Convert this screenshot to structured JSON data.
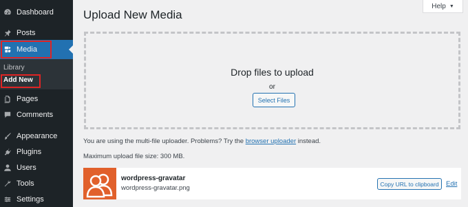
{
  "sidebar": {
    "items": [
      {
        "label": "Dashboard",
        "icon": "dashboard-icon"
      },
      {
        "label": "Posts",
        "icon": "pin-icon"
      },
      {
        "label": "Media",
        "icon": "media-icon"
      },
      {
        "label": "Pages",
        "icon": "page-icon"
      },
      {
        "label": "Comments",
        "icon": "comment-icon"
      },
      {
        "label": "Appearance",
        "icon": "brush-icon"
      },
      {
        "label": "Plugins",
        "icon": "plugin-icon"
      },
      {
        "label": "Users",
        "icon": "user-icon"
      },
      {
        "label": "Tools",
        "icon": "wrench-icon"
      },
      {
        "label": "Settings",
        "icon": "settings-icon"
      }
    ],
    "submenu": [
      {
        "label": "Library"
      },
      {
        "label": "Add New"
      }
    ]
  },
  "header": {
    "title": "Upload New Media",
    "help_label": "Help",
    "help_caret": "▼"
  },
  "uploader": {
    "drop_title": "Drop files to upload",
    "or_text": "or",
    "select_button": "Select Files",
    "notice_prefix": "You are using the multi-file uploader. Problems? Try the",
    "notice_link": "browser uploader",
    "notice_suffix": "instead.",
    "max_size": "Maximum upload file size: 300 MB."
  },
  "media_item": {
    "title": "wordpress-gravatar",
    "filename": "wordpress-gravatar.png",
    "copy_button": "Copy URL to clipboard",
    "edit_label": "Edit"
  },
  "colors": {
    "sidebar_bg": "#1d2327",
    "accent": "#2271b1",
    "highlight": "#e02424",
    "thumbnail": "#e1602b"
  }
}
